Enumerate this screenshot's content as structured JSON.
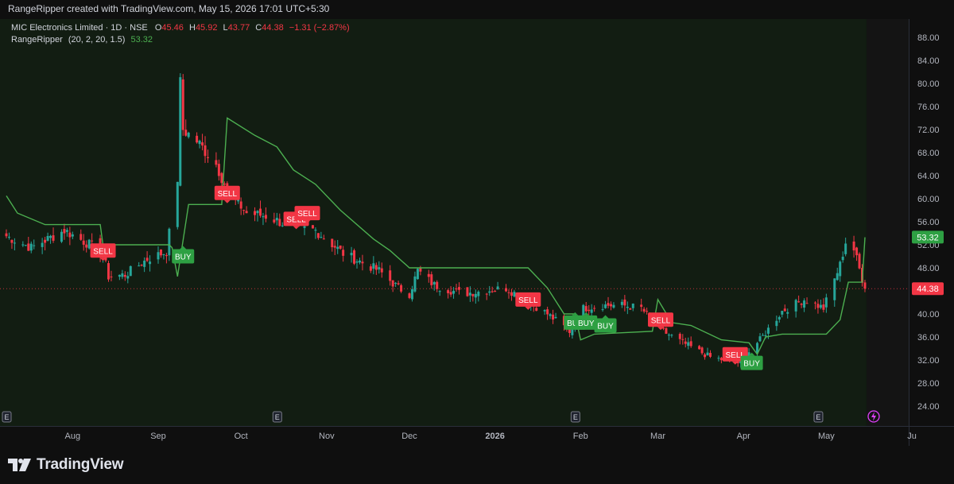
{
  "caption": "RangeRipper created with TradingView.com, May 15, 2026 17:01 UTC+5:30",
  "legend": {
    "symbol": "MIC Electronics Limited · 1D · NSE",
    "o_label": "O",
    "o": "45.46",
    "h_label": "H",
    "h": "45.92",
    "l_label": "L",
    "l": "43.77",
    "c_label": "C",
    "c": "44.38",
    "change": "−1.31 (−2.87%)",
    "indicator": "RangeRipper",
    "indicator_params": "(20, 2, 20, 1.5)",
    "indicator_value": "53.32"
  },
  "brand": "TradingView",
  "colors": {
    "up": "#26a69a",
    "down": "#f23645",
    "line": "#4caf50",
    "buy": "#2ea043",
    "sell": "#f23645",
    "bg": "#121d12",
    "bg_right": "#141414"
  },
  "chart_data": {
    "type": "candlestick",
    "y_ticks": [
      "88.00",
      "84.00",
      "80.00",
      "76.00",
      "72.00",
      "68.00",
      "64.00",
      "60.00",
      "56.00",
      "52.00",
      "48.00",
      "44.00",
      "40.00",
      "36.00",
      "32.00",
      "28.00",
      "24.00"
    ],
    "ylim": [
      24,
      88
    ],
    "x_labels": [
      "Aug",
      "Sep",
      "Oct",
      "Nov",
      "Dec",
      "2026",
      "Feb",
      "Mar",
      "Apr",
      "May",
      "Ju"
    ],
    "x_label_dates": [
      "2025-08-01",
      "2025-09-01",
      "2025-10-01",
      "2025-11-01",
      "2025-12-01",
      "2026-01-01",
      "2026-02-01",
      "2026-03-01",
      "2026-04-01",
      "2026-05-01",
      "2026-06-01"
    ],
    "xlim": [
      "2025-07-08",
      "2026-06-01"
    ],
    "last_price": "44.38",
    "indicator_label": "53.32",
    "earnings_marker": "E",
    "earnings_dates": [
      "2025-07-08",
      "2025-10-14",
      "2026-01-30",
      "2026-04-28"
    ],
    "close_anchors": [
      [
        "2025-07-08",
        53.5
      ],
      [
        "2025-07-17",
        51.5
      ],
      [
        "2025-07-29",
        54.5
      ],
      [
        "2025-08-08",
        51.8
      ],
      [
        "2025-08-12",
        50.5
      ],
      [
        "2025-08-14",
        46.5
      ],
      [
        "2025-08-20",
        46.8
      ],
      [
        "2025-08-28",
        49.5
      ],
      [
        "2025-09-04",
        50.8
      ],
      [
        "2025-09-08",
        63.5
      ],
      [
        "2025-09-09",
        80.0
      ],
      [
        "2025-09-10",
        72.0
      ],
      [
        "2025-09-15",
        70.0
      ],
      [
        "2025-09-22",
        66.0
      ],
      [
        "2025-09-26",
        61.5
      ],
      [
        "2025-10-03",
        57.5
      ],
      [
        "2025-10-10",
        57.0
      ],
      [
        "2025-10-20",
        55.0
      ],
      [
        "2025-10-28",
        54.5
      ],
      [
        "2025-11-07",
        50.5
      ],
      [
        "2025-11-20",
        47.5
      ],
      [
        "2025-11-27",
        44.5
      ],
      [
        "2025-12-01",
        43.5
      ],
      [
        "2025-12-04",
        47.5
      ],
      [
        "2025-12-10",
        45.0
      ],
      [
        "2025-12-20",
        43.5
      ],
      [
        "2026-01-05",
        44.5
      ],
      [
        "2026-01-12",
        42.5
      ],
      [
        "2026-01-20",
        40.0
      ],
      [
        "2026-01-28",
        37.0
      ],
      [
        "2026-02-02",
        41.0
      ],
      [
        "2026-02-09",
        41.5
      ],
      [
        "2026-02-16",
        41.5
      ],
      [
        "2026-02-23",
        41.0
      ],
      [
        "2026-03-01",
        37.5
      ],
      [
        "2026-03-10",
        35.0
      ],
      [
        "2026-03-20",
        32.5
      ],
      [
        "2026-03-30",
        31.5
      ],
      [
        "2026-04-07",
        35.5
      ],
      [
        "2026-04-15",
        40.5
      ],
      [
        "2026-04-23",
        42.5
      ],
      [
        "2026-04-30",
        41.0
      ],
      [
        "2026-05-06",
        48.5
      ],
      [
        "2026-05-09",
        54.5
      ],
      [
        "2026-05-12",
        49.5
      ],
      [
        "2026-05-15",
        44.38
      ]
    ],
    "series": [
      {
        "name": "RangeRipper",
        "points": [
          [
            "2025-07-08",
            60.5
          ],
          [
            "2025-07-12",
            57.5
          ],
          [
            "2025-07-22",
            55.5
          ],
          [
            "2025-07-31",
            55.5
          ],
          [
            "2025-08-11",
            55.5
          ],
          [
            "2025-08-12",
            52.0
          ],
          [
            "2025-09-05",
            52.0
          ],
          [
            "2025-09-06",
            51.5
          ],
          [
            "2025-09-08",
            46.5
          ],
          [
            "2025-09-12",
            59.0
          ],
          [
            "2025-09-24",
            59.0
          ],
          [
            "2025-09-26",
            74.0
          ],
          [
            "2025-10-06",
            71.0
          ],
          [
            "2025-10-14",
            69.0
          ],
          [
            "2025-10-20",
            65.0
          ],
          [
            "2025-10-28",
            62.5
          ],
          [
            "2025-11-06",
            58.0
          ],
          [
            "2025-11-18",
            53.0
          ],
          [
            "2025-11-24",
            51.0
          ],
          [
            "2025-12-01",
            48.0
          ],
          [
            "2026-01-13",
            48.0
          ],
          [
            "2026-01-20",
            44.5
          ],
          [
            "2026-01-26",
            40.0
          ],
          [
            "2026-01-30",
            40.0
          ],
          [
            "2026-02-01",
            35.5
          ],
          [
            "2026-02-06",
            36.5
          ],
          [
            "2026-02-27",
            37.0
          ],
          [
            "2026-03-01",
            42.5
          ],
          [
            "2026-03-06",
            38.5
          ],
          [
            "2026-03-13",
            38.0
          ],
          [
            "2026-03-24",
            35.5
          ],
          [
            "2026-04-03",
            35.0
          ],
          [
            "2026-04-06",
            33.0
          ],
          [
            "2026-04-09",
            36.0
          ],
          [
            "2026-04-15",
            36.5
          ],
          [
            "2026-05-01",
            36.5
          ],
          [
            "2026-05-06",
            39.0
          ],
          [
            "2026-05-09",
            45.5
          ],
          [
            "2026-05-14",
            45.5
          ],
          [
            "2026-05-15",
            53.3
          ]
        ]
      }
    ],
    "signals": [
      {
        "type": "SELL",
        "date": "2025-08-12",
        "price": 51.0
      },
      {
        "type": "BUY",
        "date": "2025-09-10",
        "price": 50.0
      },
      {
        "type": "SELL",
        "date": "2025-09-26",
        "price": 61.0
      },
      {
        "type": "SELL",
        "date": "2025-10-21",
        "price": 56.5
      },
      {
        "type": "SELL",
        "date": "2025-10-25",
        "price": 57.5
      },
      {
        "type": "SELL",
        "date": "2026-01-13",
        "price": 42.5
      },
      {
        "type": "BUY",
        "date": "2026-01-30",
        "price": 38.5
      },
      {
        "type": "BUY",
        "date": "2026-02-03",
        "price": 38.5
      },
      {
        "type": "BUY",
        "date": "2026-02-10",
        "price": 38.0
      },
      {
        "type": "SELL",
        "date": "2026-03-02",
        "price": 39.0
      },
      {
        "type": "SELL",
        "date": "2026-03-29",
        "price": 33.0
      },
      {
        "type": "BUY",
        "date": "2026-04-04",
        "price": 31.5
      }
    ]
  }
}
